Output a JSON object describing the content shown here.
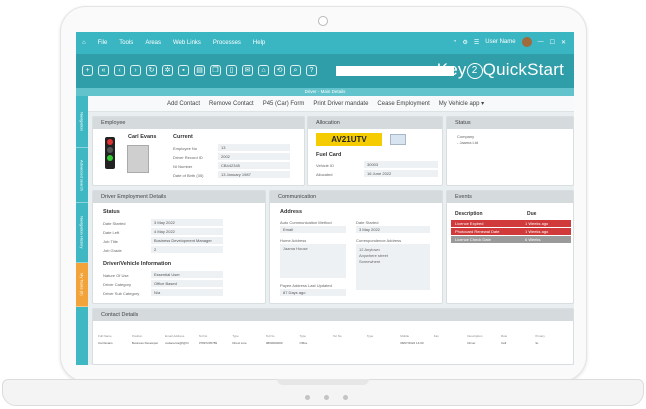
{
  "menu": {
    "items": [
      "File",
      "Tools",
      "Areas",
      "Web Links",
      "Processes",
      "Help"
    ],
    "user_label": "User Name"
  },
  "brand": {
    "prefix": "Key",
    "digit": "2",
    "suffix": "QuickStart"
  },
  "page_title": "Driver - Main Details",
  "side_tabs": [
    "Navigation",
    "Advanced search",
    "Navigation History",
    "My Tasks (0)"
  ],
  "actions": [
    "Add Contact",
    "Remove Contact",
    "P45 (Car) Form",
    "Print Driver mandate",
    "Cease Employment",
    "My Vehicle app ▾"
  ],
  "employee": {
    "header": "Employee",
    "name": "Carl Evans",
    "status_label": "Current",
    "fields": [
      {
        "label": "Employee No",
        "value": "13"
      },
      {
        "label": "Driver Record ID",
        "value": "2002"
      },
      {
        "label": "NI Number",
        "value": "CB442345"
      },
      {
        "label": "Date of Birth (35)",
        "value": "13 January 1987"
      }
    ]
  },
  "allocation": {
    "header": "Allocation",
    "plate": "AV21UTV",
    "fuel_card_label": "Fuel Card",
    "fields": [
      {
        "label": "Vehicle ID",
        "value": "30003"
      },
      {
        "label": "Allocated",
        "value": "16 June 2022"
      }
    ]
  },
  "status": {
    "header": "Status",
    "items": [
      "Company",
      "- Jaama Ltd"
    ]
  },
  "employment": {
    "header": "Driver Employment Details",
    "status_title": "Status",
    "fields": [
      {
        "label": "Date Started",
        "value": "3 May 2022"
      },
      {
        "label": "Date Left",
        "value": "4 May 2022"
      },
      {
        "label": "Job Title",
        "value": "Business Development Manager"
      },
      {
        "label": "Job Grade",
        "value": "2"
      }
    ],
    "vehicle_title": "Driver/Vehicle Information",
    "vehicle_fields": [
      {
        "label": "Nature Of Use",
        "value": "Essential User"
      },
      {
        "label": "Driver Category",
        "value": "Office Based"
      },
      {
        "label": "Driver Sub Category",
        "value": "N/a"
      }
    ]
  },
  "communication": {
    "header": "Communication",
    "address_title": "Address",
    "auto_method_label": "Auto Communication Method",
    "auto_method_value": "Email",
    "date_started_label": "Date Started",
    "date_started_value": "3 May 2022",
    "home_label": "Home Address",
    "home_value": "Jaama House",
    "corr_label": "Correspondence Address",
    "corr_lines": [
      "12 Anytown",
      "Anywhere street",
      "Somewhere"
    ],
    "last_updated_label": "Payee Address Last Updated",
    "last_updated_value": "87 Days ago"
  },
  "events": {
    "header": "Events",
    "col_desc": "Description",
    "col_due": "Due",
    "rows": [
      {
        "desc": "Licence Expired",
        "due": "1 Weeks ago",
        "color": "#d03a3a"
      },
      {
        "desc": "Photocard Renewal Date",
        "due": "1 Weeks ago",
        "color": "#d03a3a"
      },
      {
        "desc": "Licence Check Date",
        "due": "6 Weeks",
        "color": "#9a9a9a"
      }
    ]
  },
  "contact": {
    "header": "Contact Details",
    "columns": [
      "Full Name",
      "Position",
      "Email Address",
      "Tel No",
      "Type",
      "Tel No",
      "Type",
      "Tel No",
      "Type",
      "Mobile",
      "Fax",
      "Description",
      "Role",
      "Primary"
    ],
    "row": [
      "Carl Evans",
      "Business Developer",
      "cudanerva@f@ht",
      "07897235789",
      "Direct Line",
      "0800000000",
      "Office",
      "",
      "",
      "08/07/2022 14:00",
      "",
      "Driver",
      "Cell",
      "No"
    ]
  },
  "colors": {
    "menubar": "#3ab6c2",
    "toolbar": "#2f9ea9",
    "plate": "#f5cc00",
    "event_red": "#d03a3a"
  }
}
